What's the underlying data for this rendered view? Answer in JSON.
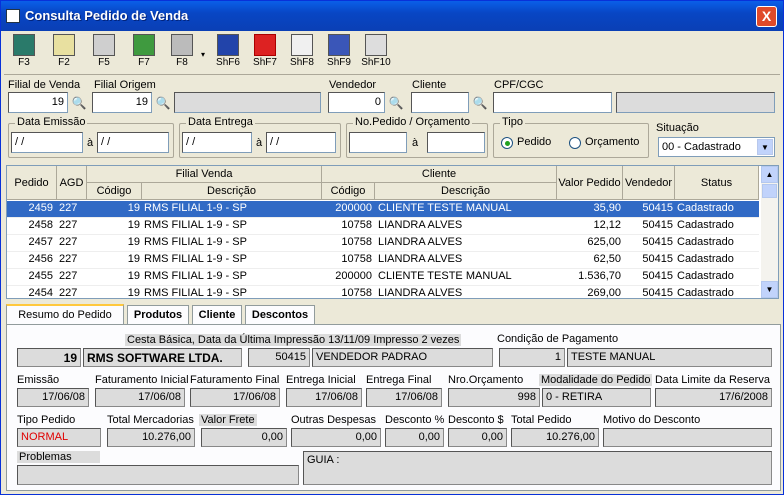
{
  "window": {
    "title": "Consulta Pedido de Venda",
    "close": "X"
  },
  "toolbar": {
    "buttons": [
      {
        "label": "F3",
        "icon": "exit-door-icon"
      },
      {
        "label": "F2",
        "icon": "new-document-icon"
      },
      {
        "label": "F5",
        "icon": "print-preview-icon"
      },
      {
        "label": "F7",
        "icon": "spreadsheet-icon"
      },
      {
        "label": "F8",
        "icon": "printer-icon"
      },
      {
        "label": "ShF6",
        "icon": "save-disk-icon"
      },
      {
        "label": "ShF7",
        "icon": "truck-icon"
      },
      {
        "label": "ShF8",
        "icon": "email-check-icon"
      },
      {
        "label": "ShF9",
        "icon": "monitor-icon"
      },
      {
        "label": "ShF10",
        "icon": "lock-icon"
      }
    ],
    "dropdown": "▾"
  },
  "filters": {
    "filial_venda_label": "Filial de Venda",
    "filial_venda": "19",
    "filial_origem_label": "Filial Origem",
    "filial_origem": "19",
    "filial_origem_desc": "",
    "vendedor_label": "Vendedor",
    "vendedor": "0",
    "cliente_label": "Cliente",
    "cliente": "",
    "cpf_label": "CPF/CGC",
    "cpf": "",
    "cpf_desc": "",
    "data_emissao_label": "Data Emissão",
    "data_emissao_de": " / /",
    "data_emissao_ate": " / /",
    "a1": "à",
    "data_entrega_label": "Data Entrega",
    "data_entrega_de": " / /",
    "data_entrega_ate": " / /",
    "a2": "à",
    "no_pedido_label": "No.Pedido / Orçamento",
    "no_pedido_de": "",
    "no_pedido_ate": "",
    "a3": "à",
    "tipo_label": "Tipo",
    "tipo_pedido": "Pedido",
    "tipo_orcamento": "Orçamento",
    "situacao_label": "Situação",
    "situacao": "00 - Cadastrado"
  },
  "grid": {
    "headers": {
      "pedido": "Pedido",
      "agd": "AGD",
      "filial_venda": "Filial Venda",
      "codigo": "Código",
      "descricao": "Descrição",
      "cliente": "Cliente",
      "codigo2": "Código",
      "descricao2": "Descrição",
      "valor": "Valor Pedido",
      "vendedor": "Vendedor",
      "status": "Status"
    },
    "rows": [
      {
        "pedido": "2459",
        "agd": "227",
        "fcod": "19",
        "fdesc": "RMS FILIAL 1-9 - SP",
        "ccod": "200000",
        "cdesc": "CLIENTE TESTE MANUAL",
        "valor": "35,90",
        "vend": "50415",
        "status": "Cadastrado"
      },
      {
        "pedido": "2458",
        "agd": "227",
        "fcod": "19",
        "fdesc": "RMS FILIAL 1-9 - SP",
        "ccod": "10758",
        "cdesc": "LIANDRA ALVES",
        "valor": "12,12",
        "vend": "50415",
        "status": "Cadastrado"
      },
      {
        "pedido": "2457",
        "agd": "227",
        "fcod": "19",
        "fdesc": "RMS FILIAL 1-9 - SP",
        "ccod": "10758",
        "cdesc": "LIANDRA ALVES",
        "valor": "625,00",
        "vend": "50415",
        "status": "Cadastrado"
      },
      {
        "pedido": "2456",
        "agd": "227",
        "fcod": "19",
        "fdesc": "RMS FILIAL 1-9 - SP",
        "ccod": "10758",
        "cdesc": "LIANDRA ALVES",
        "valor": "62,50",
        "vend": "50415",
        "status": "Cadastrado"
      },
      {
        "pedido": "2455",
        "agd": "227",
        "fcod": "19",
        "fdesc": "RMS FILIAL 1-9 - SP",
        "ccod": "200000",
        "cdesc": "CLIENTE TESTE MANUAL",
        "valor": "1.536,70",
        "vend": "50415",
        "status": "Cadastrado"
      },
      {
        "pedido": "2454",
        "agd": "227",
        "fcod": "19",
        "fdesc": "RMS FILIAL 1-9 - SP",
        "ccod": "10758",
        "cdesc": "LIANDRA ALVES",
        "valor": "269,00",
        "vend": "50415",
        "status": "Cadastrado"
      }
    ]
  },
  "tabs": [
    "Resumo do Pedido",
    "Produtos",
    "Cliente",
    "Descontos"
  ],
  "resumo": {
    "cesta": "Cesta Básica, Data da Última Impressão 13/11/09 Impresso 2 vezes",
    "filial_cod": "19",
    "filial_nome": "RMS SOFTWARE LTDA.",
    "vend_cod": "50415",
    "vend_nome": "VENDEDOR PADRAO",
    "cond_label": "Condição de Pagamento",
    "cond_cod": "1",
    "cond_nome": "TESTE MANUAL",
    "emissao_label": "Emissão",
    "emissao": "17/06/08",
    "fat_ini_label": "Faturamento Inicial",
    "fat_ini": "17/06/08",
    "fat_fin_label": "Faturamento Final",
    "fat_fin": "17/06/08",
    "ent_ini_label": "Entrega Inicial",
    "ent_ini": "17/06/08",
    "ent_fin_label": "Entrega Final",
    "ent_fin": "17/06/08",
    "nro_orc_label": "Nro.Orçamento",
    "nro_orc": "998",
    "mod_label": "Modalidade do Pedido",
    "mod": "0 - RETIRA",
    "data_lim_label": "Data Limite da Reserva",
    "data_lim": "17/6/2008",
    "tipo_label": "Tipo Pedido",
    "tipo": "NORMAL",
    "total_merc_label": "Total Mercadorias",
    "total_merc": "10.276,00",
    "frete_label": "Valor Frete",
    "frete": "0,00",
    "outras_label": "Outras Despesas",
    "outras": "0,00",
    "desc_pct_label": "Desconto %",
    "desc_pct": "0,00",
    "desc_val_label": "Desconto $",
    "desc_val": "0,00",
    "total_label": "Total Pedido",
    "total": "10.276,00",
    "motivo_label": "Motivo do Desconto",
    "motivo": "",
    "problemas_label": "Problemas",
    "problemas": "",
    "guia": "GUIA :"
  },
  "colors": {
    "titlebar": "#0a5fe8",
    "selection": "#316ac5",
    "tipo_text": "#e00000"
  }
}
